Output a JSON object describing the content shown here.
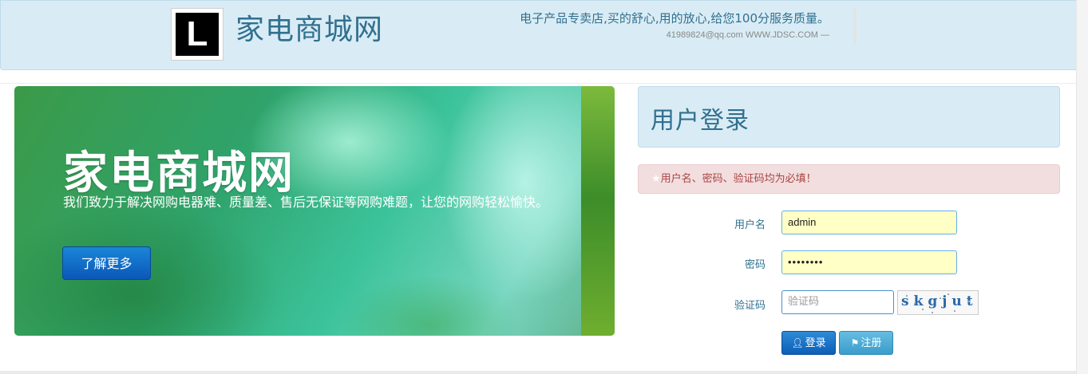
{
  "header": {
    "logo_letter": "L",
    "site_title": "家电商城网",
    "slogan": "电子产品专卖店,买的舒心,用的放心,给您100分服务质量。",
    "contact": "41989824@qq.com WWW.JDSC.COM —"
  },
  "banner": {
    "title": "家电商城网",
    "description": "我们致力于解决网购电器难、质量差、售后无保证等网购难题，让您的网购轻松愉快。",
    "button_label": "了解更多"
  },
  "login": {
    "title": "用户登录",
    "alert_star": "★",
    "alert_text": "用户名、密码、验证码均为必填！",
    "username_label": "用户名",
    "username_value": "admin",
    "password_label": "密码",
    "password_value": "••••••••",
    "captcha_label": "验证码",
    "captcha_placeholder": "验证码",
    "captcha_image_text": "skgjut",
    "login_button": "登录",
    "register_button": "注册",
    "login_icon": "user-icon",
    "register_icon": "bookmark-icon"
  },
  "colors": {
    "header_bg": "#d9ecf5",
    "accent_text": "#31708f",
    "alert_bg": "#f2dede",
    "alert_text": "#a94442",
    "input_autofill_bg": "#ffffc6",
    "primary_button": "#0d5fb8",
    "info_button": "#3a9dcc"
  }
}
